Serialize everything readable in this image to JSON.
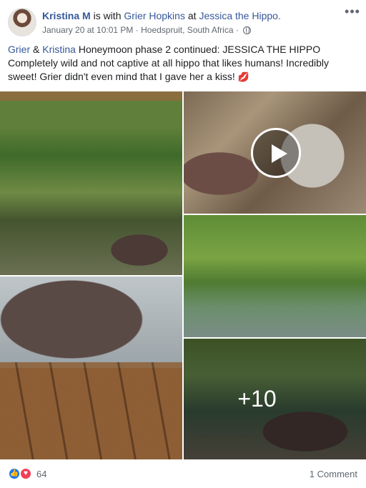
{
  "post": {
    "author": "Kristina M",
    "with_text": "is with",
    "tag_person": "Grier Hopkins",
    "at_text": "at",
    "place": "Jessica the Hippo.",
    "date": "January 20 at 10:01 PM",
    "separator": "·",
    "location": "Hoedspruit, South Africa",
    "more_label": "•••",
    "text_link1": "Grier",
    "text_amp": " & ",
    "text_link2": "Kristina",
    "text_body": " Honeymoon phase 2 continued: JESSICA THE HIPPO Completely wild and not captive at all hippo that likes humans! Incredibly sweet! Grier didn't even mind that I gave her a kiss! ",
    "kiss_emoji": "💋"
  },
  "photos": {
    "more_count": "+10"
  },
  "footer": {
    "like_icon": "👍",
    "love_icon": "♥",
    "reactions": "64",
    "comments": "1 Comment"
  },
  "colors": {
    "link": "#365899",
    "like": "#1877f2",
    "love": "#f33e58",
    "meta": "#616770"
  }
}
